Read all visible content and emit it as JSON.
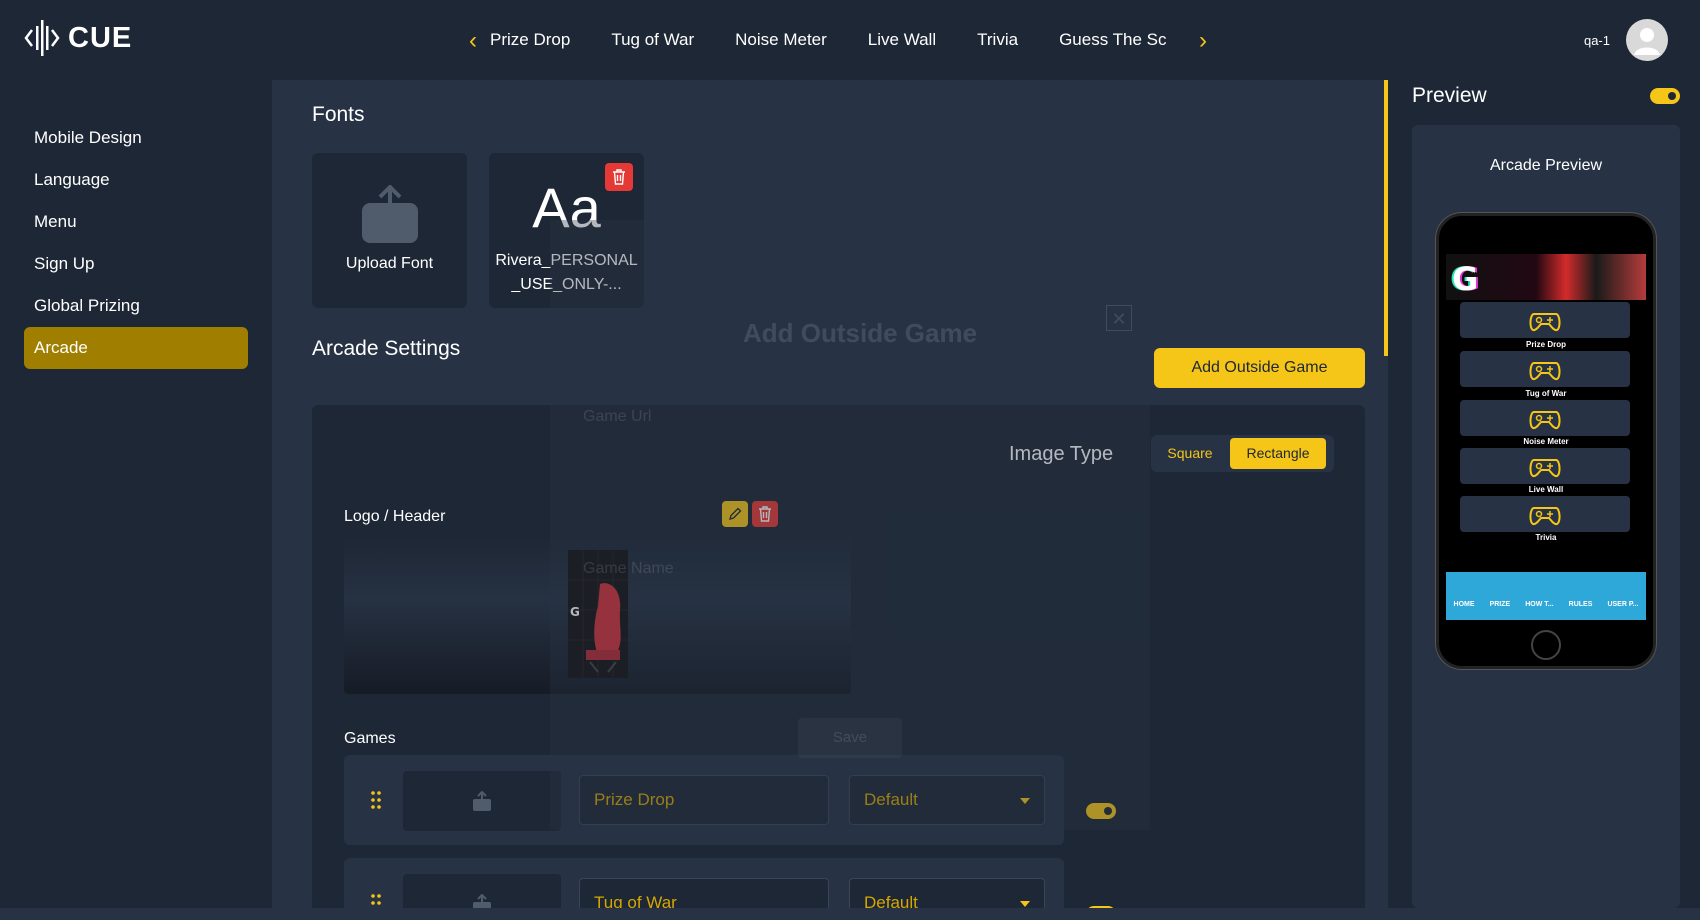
{
  "app": {
    "brand": "CUE"
  },
  "nav": {
    "tabs": [
      "Prize Drop",
      "Tug of War",
      "Noise Meter",
      "Live Wall",
      "Trivia",
      "Guess The Sc"
    ]
  },
  "user": {
    "name": "qa-1"
  },
  "sidebar": {
    "items": [
      {
        "label": "Mobile Design",
        "active": false
      },
      {
        "label": "Language",
        "active": false
      },
      {
        "label": "Menu",
        "active": false
      },
      {
        "label": "Sign Up",
        "active": false
      },
      {
        "label": "Global Prizing",
        "active": false
      },
      {
        "label": "Arcade",
        "active": true
      }
    ]
  },
  "fonts": {
    "title": "Fonts",
    "upload_label": "Upload Font",
    "font_sample": "Aa",
    "font_name_line1": "Rivera_PERSONAL",
    "font_name_line2": "_USE_ONLY-..."
  },
  "arcade": {
    "title": "Arcade Settings",
    "add_outside_game_button": "Add Outside Game",
    "image_type_label": "Image Type",
    "image_type_options": [
      "Square",
      "Rectangle"
    ],
    "image_type_selected": "Rectangle",
    "logo_header_label": "Logo / Header",
    "games_label": "Games",
    "games": [
      {
        "name": "Prize Drop",
        "mode": "Default",
        "enabled": true
      },
      {
        "name": "Tug of War",
        "mode": "Default",
        "enabled": true
      }
    ]
  },
  "modal_ghost": {
    "title": "Add Outside Game",
    "url_label": "Game Url",
    "name_label": "Game Name",
    "save_label": "Save"
  },
  "preview": {
    "title": "Preview",
    "enabled": true,
    "panel_label": "Arcade Preview",
    "logo_letter": "G",
    "games": [
      "Prize Drop",
      "Tug of War",
      "Noise Meter",
      "Live Wall",
      "Trivia"
    ],
    "bottom_nav": [
      "HOME",
      "PRIZE",
      "HOW T...",
      "RULES",
      "USER P..."
    ]
  },
  "colors": {
    "accent": "#f5c518",
    "active_sidebar": "#a07e00",
    "danger": "#e53935",
    "bg_dark": "#1e2735",
    "bg_panel": "#273345",
    "phone_nav": "#2ea8d9"
  }
}
